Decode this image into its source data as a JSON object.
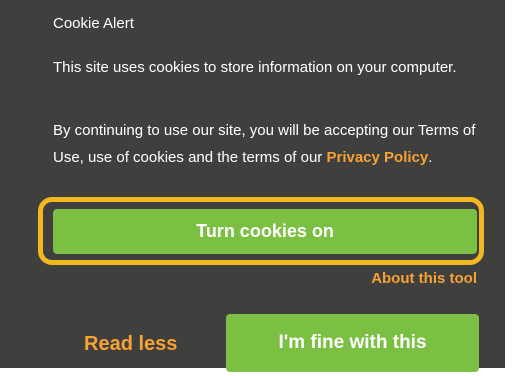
{
  "dialog": {
    "title": "Cookie Alert",
    "message": "This site uses cookies to store information on your computer.",
    "terms_text": "By continuing to use our site, you will be accepting our Terms of Use, use of cookies and the terms of our ",
    "privacy_link": "Privacy Policy",
    "terms_end": "."
  },
  "actions": {
    "turn_on_label": "Turn cookies on",
    "about_label": "About this tool",
    "read_less_label": "Read less",
    "accept_label": "I'm fine with this"
  },
  "colors": {
    "background": "#3f3f3e",
    "accent_green": "#7bc043",
    "link_orange": "#f7a234",
    "highlight_yellow": "#f2b81f"
  }
}
